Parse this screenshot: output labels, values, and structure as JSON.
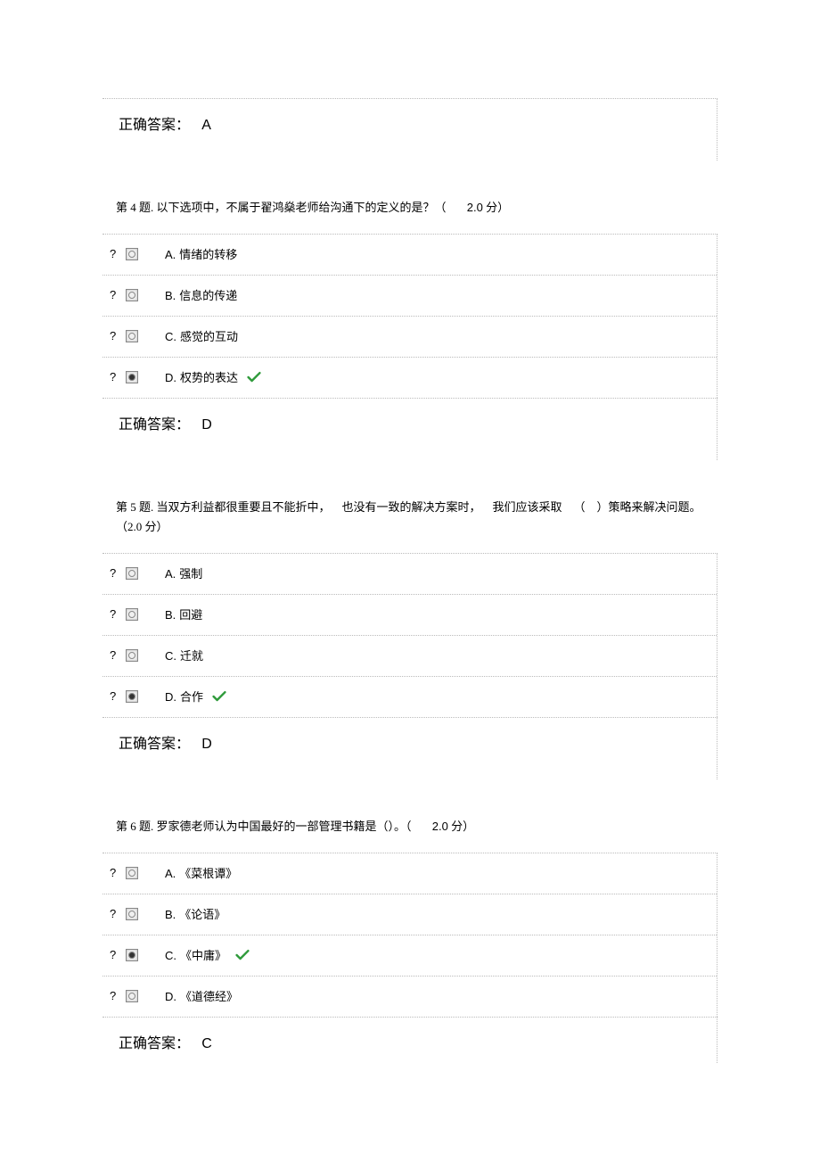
{
  "answer_label": "正确答案：",
  "points_unit": "分）",
  "questions": [
    {
      "correct_answer": "A",
      "correct_answer_value": "A",
      "options": null
    },
    {
      "number_label": "第 4 题.",
      "text": "以下选项中，不属于翟鸿燊老师给沟通下的定义的是？（",
      "points": "2.0",
      "options": [
        {
          "letter": "A.",
          "text": "情绪的转移",
          "selected": false,
          "correct": false
        },
        {
          "letter": "B.",
          "text": "信息的传递",
          "selected": false,
          "correct": false
        },
        {
          "letter": "C.",
          "text": "感觉的互动",
          "selected": false,
          "correct": false
        },
        {
          "letter": "D.",
          "text": "权势的表达",
          "selected": true,
          "correct": true
        }
      ],
      "correct_answer_value": "D"
    },
    {
      "number_label": "第 5 题.",
      "text": "当双方利益都很重要且不能折中， 也没有一致的解决方案时， 我们应该采取 （ ）策略来解决问题。",
      "points_inline": "（2.0 分）",
      "options": [
        {
          "letter": "A.",
          "text": "强制",
          "selected": false,
          "correct": false
        },
        {
          "letter": "B.",
          "text": "回避",
          "selected": false,
          "correct": false
        },
        {
          "letter": "C.",
          "text": "迁就",
          "selected": false,
          "correct": false
        },
        {
          "letter": "D.",
          "text": "合作",
          "selected": true,
          "correct": true
        }
      ],
      "correct_answer_value": "D"
    },
    {
      "number_label": "第 6 题.",
      "text": "罗家德老师认为中国最好的一部管理书籍是（）。（",
      "points": "2.0",
      "options": [
        {
          "letter": "A.",
          "text": "《菜根谭》",
          "selected": false,
          "correct": false
        },
        {
          "letter": "B.",
          "text": "《论语》",
          "selected": false,
          "correct": false
        },
        {
          "letter": "C.",
          "text": "《中庸》",
          "selected": true,
          "correct": true
        },
        {
          "letter": "D.",
          "text": "《道德经》",
          "selected": false,
          "correct": false
        }
      ],
      "correct_answer_value": "C"
    }
  ]
}
